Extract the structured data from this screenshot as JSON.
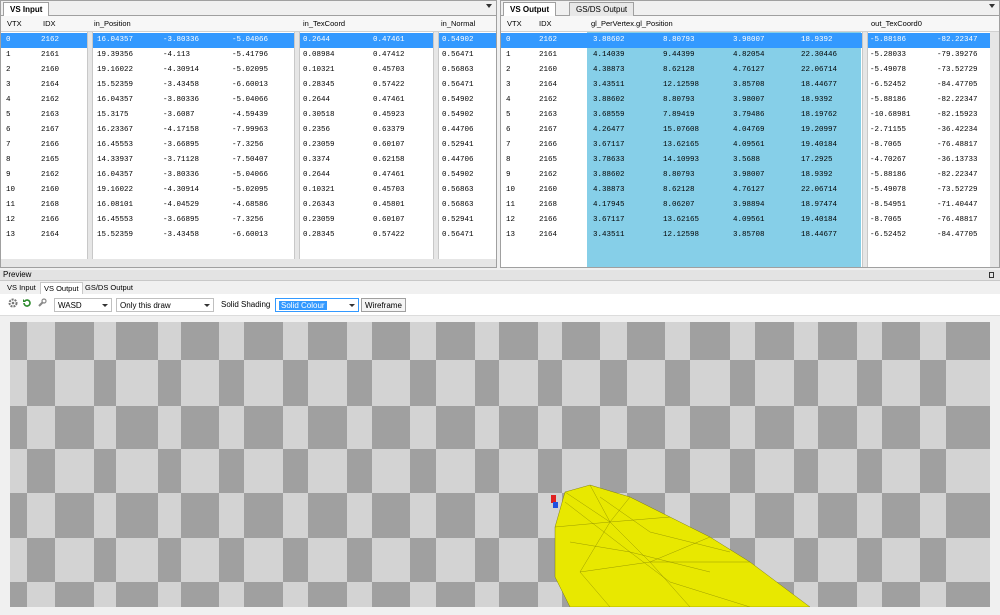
{
  "vs_input": {
    "tab_label": "VS Input",
    "headers": [
      "VTX",
      "IDX",
      "in_Position",
      "in_TexCoord",
      "in_Normal"
    ],
    "rows": [
      [
        "0",
        "2162",
        "16.04357",
        "-3.80336",
        "-5.04066",
        "0.2644",
        "0.47461",
        "0.54902"
      ],
      [
        "1",
        "2161",
        "19.39356",
        "-4.113",
        "-5.41796",
        "0.08984",
        "0.47412",
        "0.56471"
      ],
      [
        "2",
        "2160",
        "19.16022",
        "-4.30914",
        "-5.02095",
        "0.10321",
        "0.45703",
        "0.56863"
      ],
      [
        "3",
        "2164",
        "15.52359",
        "-3.43458",
        "-6.60013",
        "0.28345",
        "0.57422",
        "0.56471"
      ],
      [
        "4",
        "2162",
        "16.04357",
        "-3.80336",
        "-5.04066",
        "0.2644",
        "0.47461",
        "0.54902"
      ],
      [
        "5",
        "2163",
        "15.3175",
        "-3.6087",
        "-4.59439",
        "0.30518",
        "0.45923",
        "0.54902"
      ],
      [
        "6",
        "2167",
        "16.23367",
        "-4.17158",
        "-7.99963",
        "0.2356",
        "0.63379",
        "0.44706"
      ],
      [
        "7",
        "2166",
        "16.45553",
        "-3.66895",
        "-7.3256",
        "0.23059",
        "0.60107",
        "0.52941"
      ],
      [
        "8",
        "2165",
        "14.33937",
        "-3.71128",
        "-7.50407",
        "0.3374",
        "0.62158",
        "0.44706"
      ],
      [
        "9",
        "2162",
        "16.04357",
        "-3.80336",
        "-5.04066",
        "0.2644",
        "0.47461",
        "0.54902"
      ],
      [
        "10",
        "2160",
        "19.16022",
        "-4.30914",
        "-5.02095",
        "0.10321",
        "0.45703",
        "0.56863"
      ],
      [
        "11",
        "2168",
        "16.08101",
        "-4.04529",
        "-4.68586",
        "0.26343",
        "0.45801",
        "0.56863"
      ],
      [
        "12",
        "2166",
        "16.45553",
        "-3.66895",
        "-7.3256",
        "0.23059",
        "0.60107",
        "0.52941"
      ],
      [
        "13",
        "2164",
        "15.52359",
        "-3.43458",
        "-6.60013",
        "0.28345",
        "0.57422",
        "0.56471"
      ]
    ]
  },
  "vs_output": {
    "tabs": [
      "VS Output",
      "GS/DS Output"
    ],
    "headers": [
      "VTX",
      "IDX",
      "gl_PerVertex.gl_Position",
      "out_TexCoord0"
    ],
    "rows": [
      [
        "0",
        "2162",
        "3.88602",
        "8.80793",
        "3.98007",
        "18.9392",
        "-5.88186",
        "-82.22347"
      ],
      [
        "1",
        "2161",
        "4.14039",
        "9.44399",
        "4.82054",
        "22.30446",
        "-5.28033",
        "-79.39276"
      ],
      [
        "2",
        "2160",
        "4.38873",
        "8.62128",
        "4.76127",
        "22.06714",
        "-5.49078",
        "-73.52729"
      ],
      [
        "3",
        "2164",
        "3.43511",
        "12.12598",
        "3.85708",
        "18.44677",
        "-6.52452",
        "-84.47705"
      ],
      [
        "4",
        "2162",
        "3.88602",
        "8.80793",
        "3.98007",
        "18.9392",
        "-5.88186",
        "-82.22347"
      ],
      [
        "5",
        "2163",
        "3.68559",
        "7.89419",
        "3.79486",
        "18.19762",
        "-10.68981",
        "-82.15923"
      ],
      [
        "6",
        "2167",
        "4.26477",
        "15.07608",
        "4.04769",
        "19.20997",
        "-2.71155",
        "-36.42234"
      ],
      [
        "7",
        "2166",
        "3.67117",
        "13.62165",
        "4.09561",
        "19.40184",
        "-8.7065",
        "-76.48817"
      ],
      [
        "8",
        "2165",
        "3.78633",
        "14.10993",
        "3.5688",
        "17.2925",
        "-4.70267",
        "-36.13733"
      ],
      [
        "9",
        "2162",
        "3.88602",
        "8.80793",
        "3.98007",
        "18.9392",
        "-5.88186",
        "-82.22347"
      ],
      [
        "10",
        "2160",
        "4.38873",
        "8.62128",
        "4.76127",
        "22.06714",
        "-5.49078",
        "-73.52729"
      ],
      [
        "11",
        "2168",
        "4.17945",
        "8.06207",
        "3.98894",
        "18.97474",
        "-8.54951",
        "-71.40447"
      ],
      [
        "12",
        "2166",
        "3.67117",
        "13.62165",
        "4.09561",
        "19.40184",
        "-8.7065",
        "-76.48817"
      ],
      [
        "13",
        "2164",
        "3.43511",
        "12.12598",
        "3.85708",
        "18.44677",
        "-6.52452",
        "-84.47705"
      ]
    ]
  },
  "preview": {
    "title": "Preview",
    "tabs": [
      "VS Input",
      "VS Output",
      "GS/DS Output"
    ],
    "camera_mode": "WASD",
    "draw_range": "Only this draw",
    "shading_label": "Solid Shading",
    "shading_value": "Solid Colour",
    "wireframe_label": "Wireframe"
  },
  "colors": {
    "selection": "#3399ff",
    "output_highlight": "#86cfe8",
    "mesh": "#e8e800",
    "checker_dark": "#a0a0a0",
    "checker_light": "#d3d3d3"
  }
}
